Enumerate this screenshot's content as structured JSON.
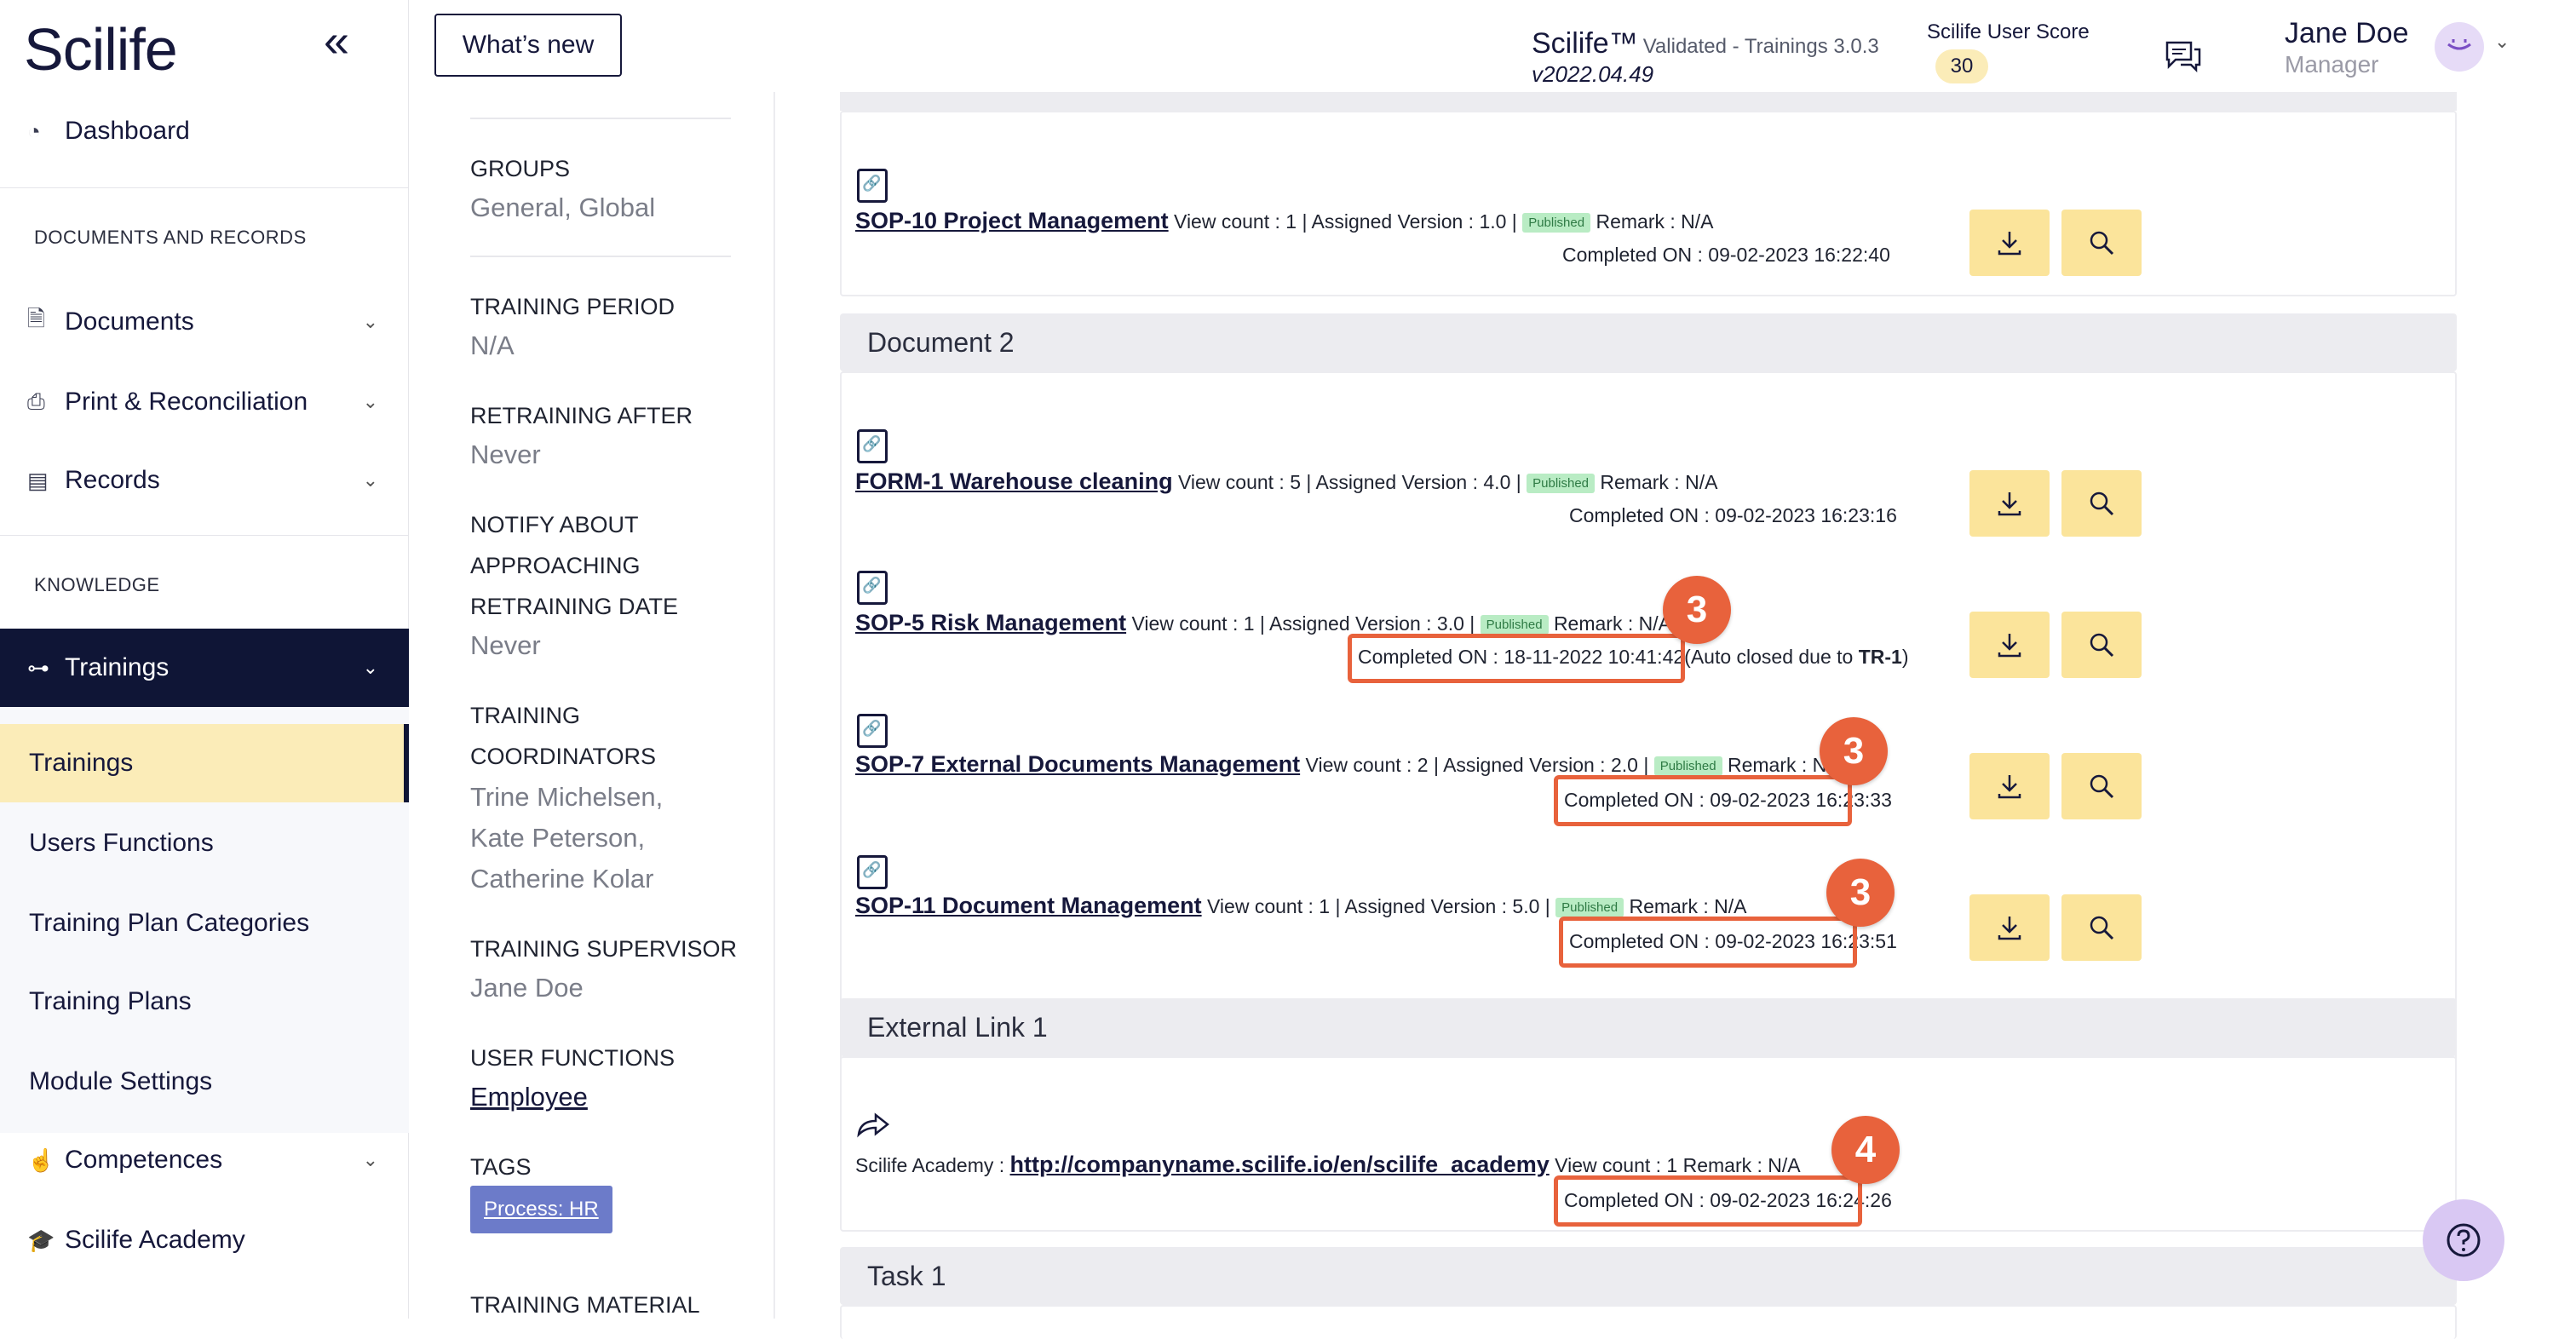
{
  "app": {
    "logo": "Scilife",
    "collapse_icon": "double-chevron-left-icon"
  },
  "header": {
    "whats_new": "What’s new",
    "app_name": "Scilife™",
    "app_subtitle": "Validated - Trainings 3.0.3",
    "version": "v2022.04.49",
    "score_label": "Scilife User Score",
    "score": "30",
    "user_name": "Jane Doe",
    "user_role": "Manager"
  },
  "sidebar": {
    "dashboard": "Dashboard",
    "section_docs": "DOCUMENTS AND RECORDS",
    "documents": "Documents",
    "print": "Print & Reconciliation",
    "records": "Records",
    "section_knowledge": "KNOWLEDGE",
    "trainings": "Trainings",
    "sub_items": [
      "Trainings",
      "Users Functions",
      "Training Plan Categories",
      "Training Plans",
      "Module Settings"
    ],
    "competences": "Competences",
    "academy": "Scilife Academy"
  },
  "info": {
    "groups_label": "GROUPS",
    "groups_value": "General, Global",
    "period_label": "TRAINING PERIOD",
    "period_value": "N/A",
    "retraining_label": "RETRAINING AFTER",
    "retraining_value": "Never",
    "notify_label_1": "NOTIFY ABOUT",
    "notify_label_2": "APPROACHING",
    "notify_label_3": "RETRAINING DATE",
    "notify_value": "Never",
    "coord_label_1": "TRAINING",
    "coord_label_2": "COORDINATORS",
    "coord_value_1": "Trine Michelsen,",
    "coord_value_2": "Kate Peterson,",
    "coord_value_3": "Catherine Kolar",
    "supervisor_label": "TRAINING SUPERVISOR",
    "supervisor_value": "Jane Doe",
    "functions_label": "USER FUNCTIONS",
    "functions_value": "Employee",
    "tags_label": "TAGS",
    "tag_value": "Process: HR",
    "material_label": "TRAINING MATERIAL"
  },
  "main": {
    "sections": {
      "doc2": "Document 2",
      "ext": "External Link 1",
      "task": "Task 1"
    },
    "doc_sop10": {
      "title": "SOP-10 Project Management",
      "meta": "View count : 1 | Assigned Version : 1.0 |",
      "status": "Published",
      "remark": "Remark : N/A",
      "completed": "Completed ON : 09-02-2023 16:22:40"
    },
    "doc_form1": {
      "title": "FORM-1 Warehouse cleaning",
      "meta": "View count : 5 | Assigned Version : 4.0 |",
      "status": "Published",
      "remark": "Remark : N/A",
      "completed": "Completed ON : 09-02-2023 16:23:16"
    },
    "doc_sop5": {
      "title": "SOP-5 Risk Management",
      "meta": "View count : 1 | Assigned Version : 3.0 |",
      "status": "Published",
      "remark": "Remark : N/A",
      "completed": "Completed ON : 18-11-2022 10:41:42",
      "auto_closed": "(Auto closed due to",
      "auto_ref": "TR-1",
      "auto_end": ")"
    },
    "doc_sop7": {
      "title": "SOP-7 External Documents Management",
      "meta": "View count : 2 | Assigned Version : 2.0 |",
      "status": "Published",
      "remark": "Remark : N/A",
      "completed": "Completed ON : 09-02-2023 16:23:33"
    },
    "doc_sop11": {
      "title": "SOP-11 Document Management",
      "meta": "View count : 1 | Assigned Version : 5.0 |",
      "status": "Published",
      "remark": "Remark : N/A",
      "completed": "Completed ON : 09-02-2023 16:23:51"
    },
    "ext_link": {
      "label": "Scilife Academy :",
      "url": "http://companyname.scilife.io/en/scilife_academy",
      "meta": "View count : 1 Remark : N/A",
      "completed": "Completed ON : 09-02-2023 16:24:26"
    },
    "badges": [
      "3",
      "3",
      "3",
      "4"
    ]
  },
  "colors": {
    "navy": "#0f1536",
    "highlight": "#e8623c",
    "button": "#fbe49b",
    "selected": "#fbecb8"
  }
}
